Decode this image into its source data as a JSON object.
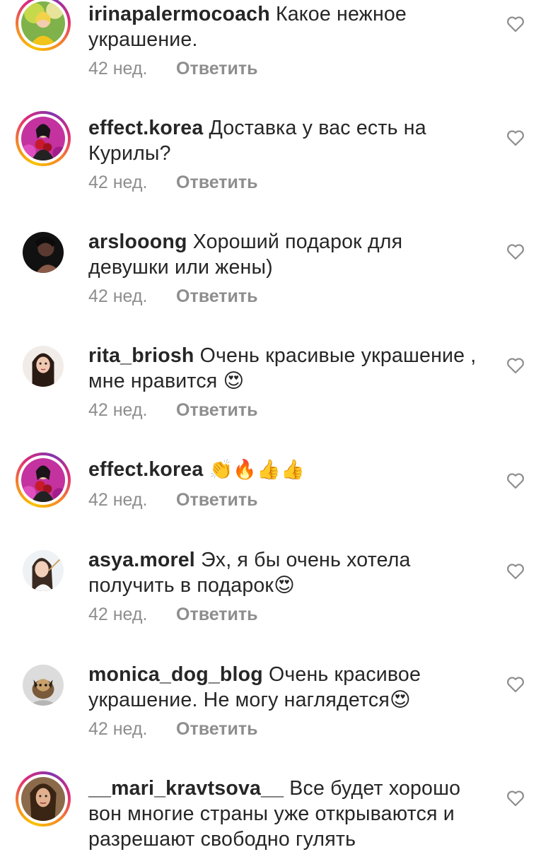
{
  "comments": [
    {
      "username": "irinapalermocoach",
      "text": "Какое нежное украшение.",
      "time": "42 нед.",
      "reply": "Ответить",
      "avatar": "woman-yellow-avatar",
      "story_ring": true
    },
    {
      "username": "effect.korea",
      "text": "Доставка у вас есть на Курилы?",
      "time": "42 нед.",
      "reply": "Ответить",
      "avatar": "woman-roses-avatar",
      "story_ring": true
    },
    {
      "username": "arslooong",
      "text": "Хороший подарок для девушки или жены)",
      "time": "42 нед.",
      "reply": "Ответить",
      "avatar": "dark-portrait-avatar",
      "story_ring": false
    },
    {
      "username": "rita_briosh",
      "text": "Очень красивые украшение , мне нравится 😍",
      "time": "42 нед.",
      "reply": "Ответить",
      "avatar": "woman-brunette-avatar",
      "story_ring": false
    },
    {
      "username": "effect.korea",
      "text": "👏🔥👍👍",
      "time": "42 нед.",
      "reply": "Ответить",
      "avatar": "woman-roses-avatar",
      "story_ring": true
    },
    {
      "username": "asya.morel",
      "text": "Эх, я бы очень хотела получить в подарок😍",
      "time": "42 нед.",
      "reply": "Ответить",
      "avatar": "woman-makeup-avatar",
      "story_ring": false
    },
    {
      "username": "monica_dog_blog",
      "text": "Очень красивое украшение. Не могу наглядется😍",
      "time": "42 нед.",
      "reply": "Ответить",
      "avatar": "dog-avatar",
      "story_ring": false
    },
    {
      "username": "__mari_kravtsova__",
      "text": "Все будет хорошо вон многие страны уже открываются и разрешают свободно гулять",
      "time": "",
      "reply": "",
      "avatar": "woman-portrait-avatar",
      "story_ring": true
    }
  ],
  "icons": {
    "like": "heart-outline-icon"
  },
  "colors": {
    "text": "#262626",
    "meta": "#8e8e8e",
    "ring_start": "#f9c300",
    "ring_end": "#8134af"
  }
}
